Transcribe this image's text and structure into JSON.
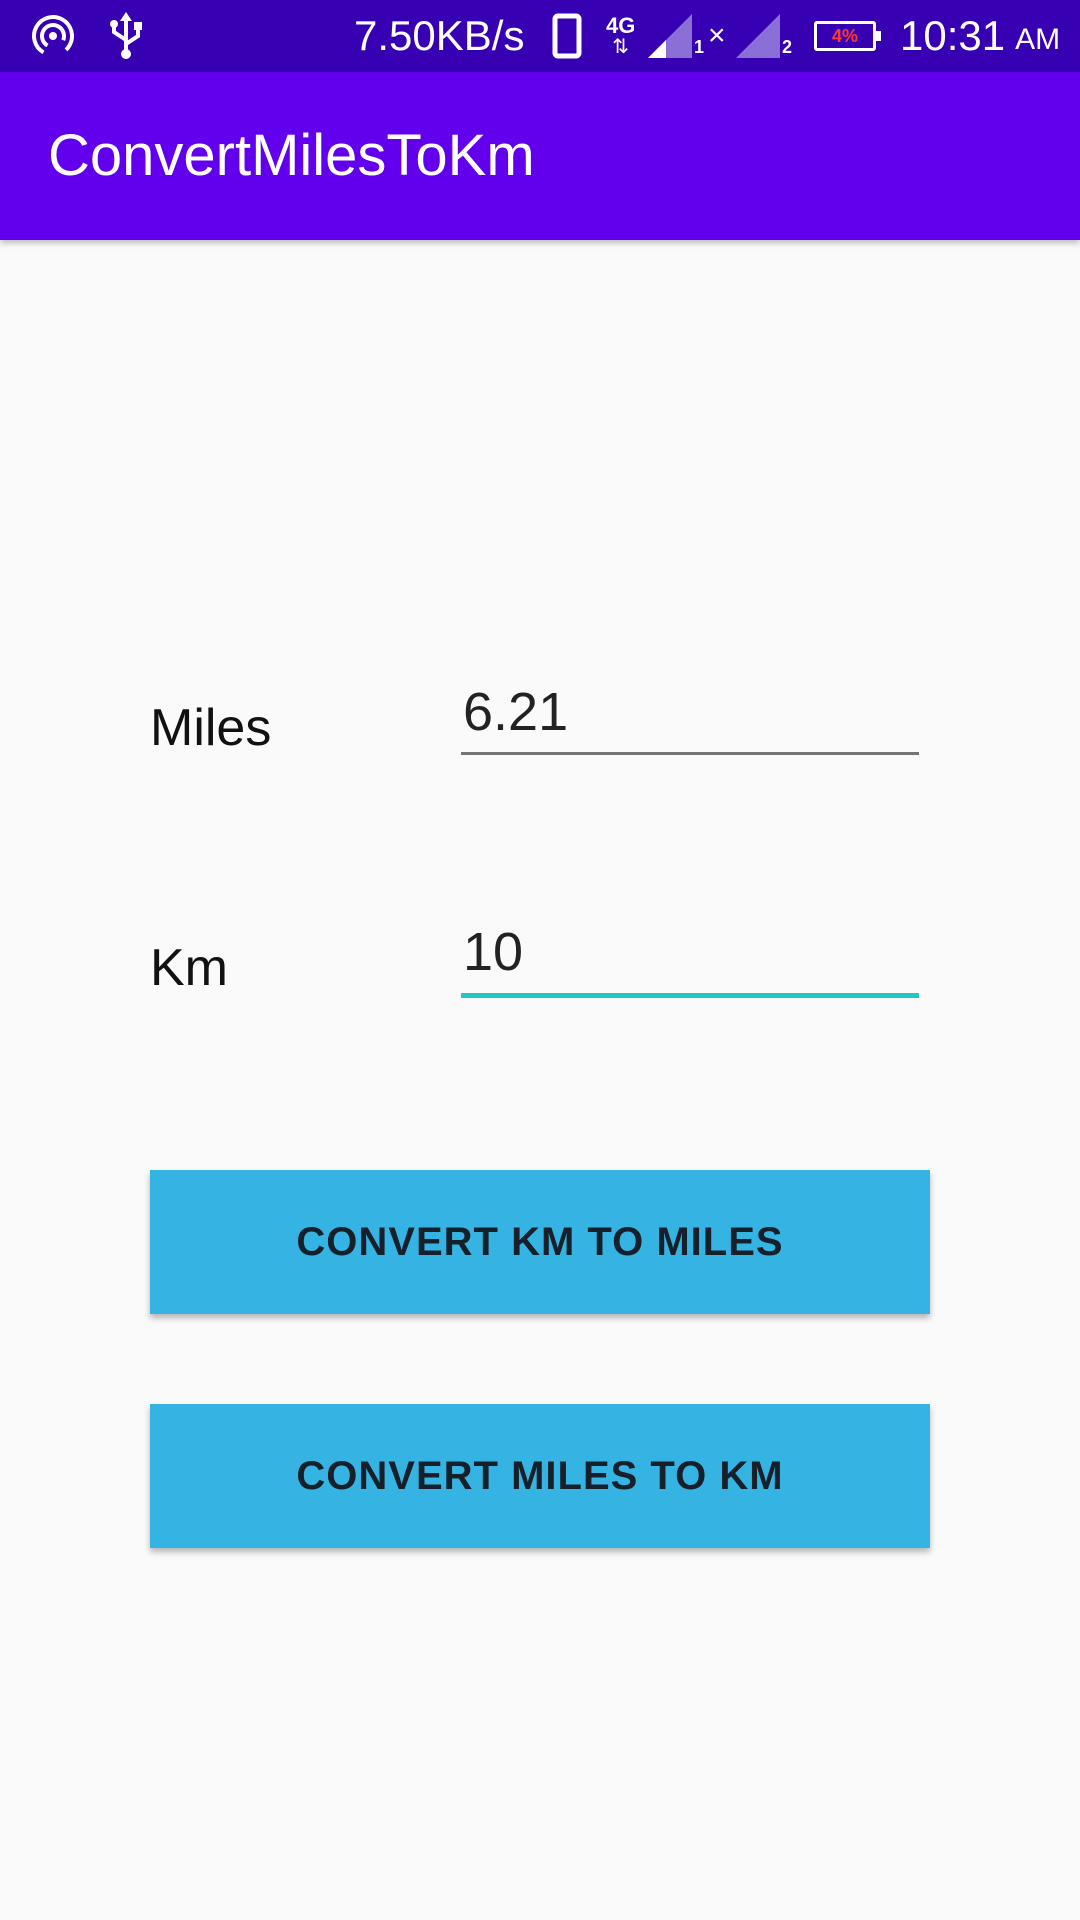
{
  "status_bar": {
    "network_speed": "7.50KB/s",
    "network_type": "4G",
    "sim1_label": "1",
    "sim2_label": "2",
    "battery_percent": "4%",
    "time": "10:31",
    "am_pm": "AM",
    "icons": [
      "hotspot-icon",
      "usb-icon",
      "phone-icon",
      "4g-icon",
      "signal-icon",
      "signal-icon",
      "battery-icon"
    ]
  },
  "app_bar": {
    "title": "ConvertMilesToKm",
    "color": "#6200ee"
  },
  "form": {
    "miles_label": "Miles",
    "miles_value": "6.21",
    "km_label": "Km",
    "km_value": "10",
    "focused_field": "km",
    "accent_color": "#1fc9c2"
  },
  "buttons": {
    "km_to_miles_label": "CONVERT KM TO MILES",
    "miles_to_km_label": "CONVERT MILES TO KM",
    "color": "#35b4e4"
  }
}
